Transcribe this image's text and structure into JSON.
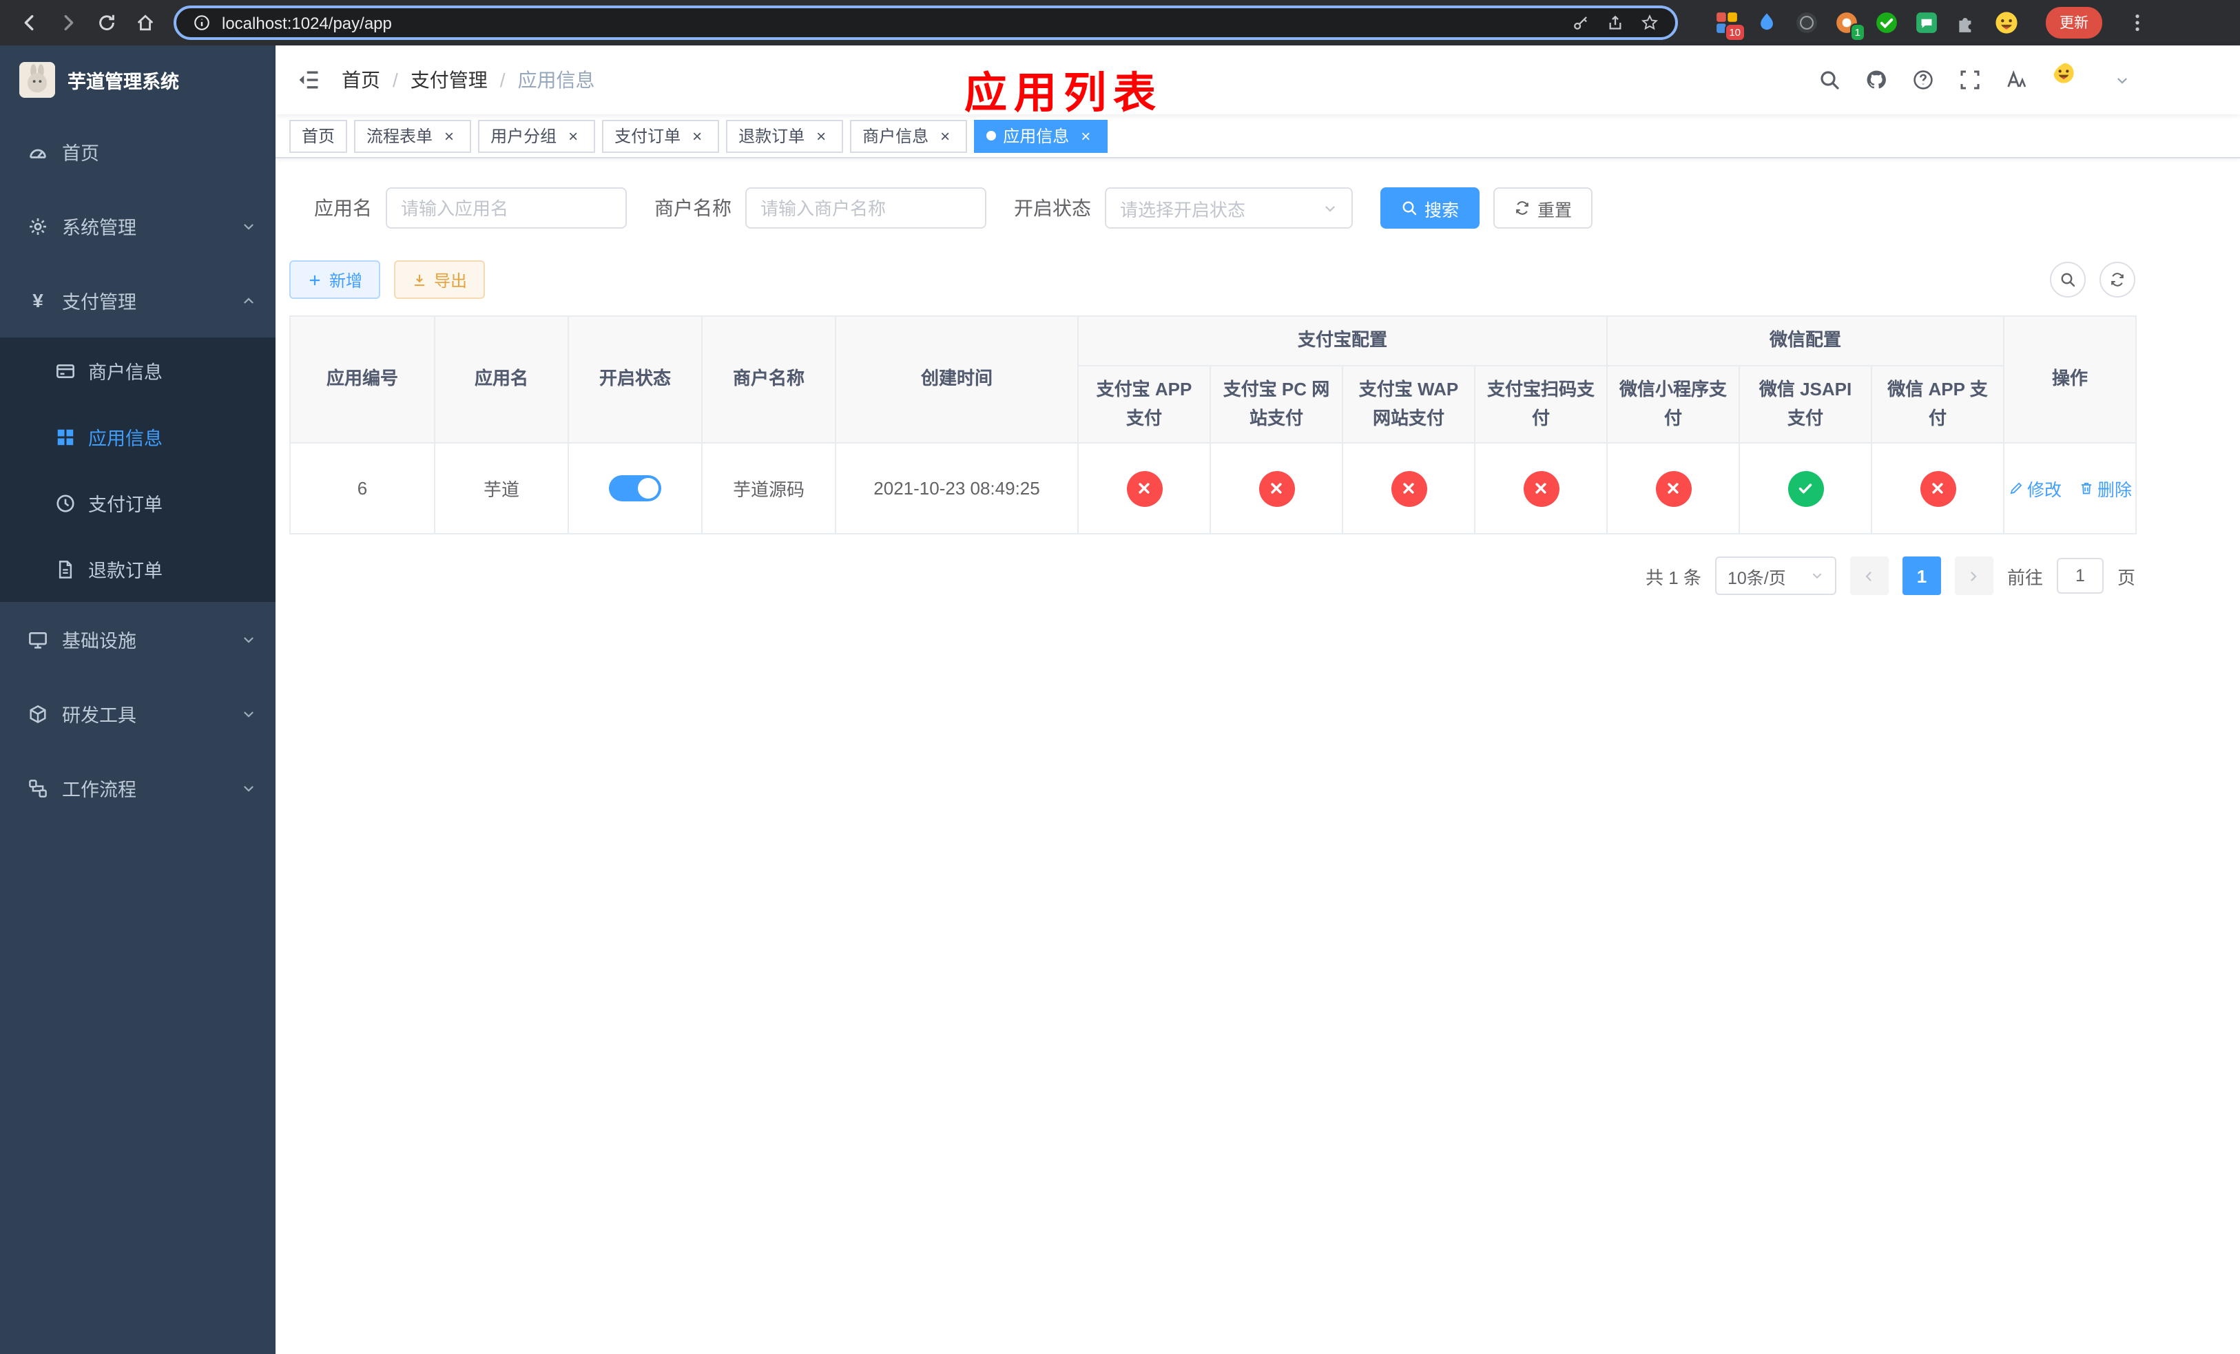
{
  "browser": {
    "url": "localhost:1024/pay/app",
    "update_button": "更新",
    "extension_badge_a": "10",
    "extension_badge_b": "1"
  },
  "sidebar": {
    "title": "芋道管理系统",
    "items": [
      {
        "label": "首页",
        "icon": "dashboard-icon",
        "expandable": false
      },
      {
        "label": "系统管理",
        "icon": "gear-icon",
        "expandable": true,
        "expanded": false
      },
      {
        "label": "支付管理",
        "icon": "yen-icon",
        "expandable": true,
        "expanded": true,
        "children": [
          {
            "label": "商户信息",
            "icon": "card-icon",
            "active": false
          },
          {
            "label": "应用信息",
            "icon": "grid-icon",
            "active": true
          },
          {
            "label": "支付订单",
            "icon": "clock-icon",
            "active": false
          },
          {
            "label": "退款订单",
            "icon": "document-icon",
            "active": false
          }
        ]
      },
      {
        "label": "基础设施",
        "icon": "monitor-icon",
        "expandable": true,
        "expanded": false
      },
      {
        "label": "研发工具",
        "icon": "cube-icon",
        "expandable": true,
        "expanded": false
      },
      {
        "label": "工作流程",
        "icon": "workflow-icon",
        "expandable": true,
        "expanded": false
      }
    ],
    "yen_glyph": "¥"
  },
  "header": {
    "breadcrumb": [
      "首页",
      "支付管理",
      "应用信息"
    ],
    "separator": "/",
    "annotation": "应用列表"
  },
  "tabs": [
    {
      "label": "首页",
      "closable": false,
      "active": false
    },
    {
      "label": "流程表单",
      "closable": true,
      "active": false
    },
    {
      "label": "用户分组",
      "closable": true,
      "active": false
    },
    {
      "label": "支付订单",
      "closable": true,
      "active": false
    },
    {
      "label": "退款订单",
      "closable": true,
      "active": false
    },
    {
      "label": "商户信息",
      "closable": true,
      "active": false
    },
    {
      "label": "应用信息",
      "closable": true,
      "active": true
    }
  ],
  "close_glyph": "×",
  "filters": {
    "app_name_label": "应用名",
    "app_name_placeholder": "请输入应用名",
    "merchant_label": "商户名称",
    "merchant_placeholder": "请输入商户名称",
    "status_label": "开启状态",
    "status_placeholder": "请选择开启状态",
    "search_button": "搜索",
    "reset_button": "重置"
  },
  "toolbar": {
    "add_button": "新增",
    "export_button": "导出"
  },
  "table": {
    "simple_columns": [
      "应用编号",
      "应用名",
      "开启状态",
      "商户名称",
      "创建时间"
    ],
    "groups": [
      {
        "label": "支付宝配置",
        "children": [
          "支付宝 APP 支付",
          "支付宝 PC 网站支付",
          "支付宝 WAP 网站支付",
          "支付宝扫码支付"
        ]
      },
      {
        "label": "微信配置",
        "children": [
          "微信小程序支付",
          "微信 JSAPI 支付",
          "微信 APP 支付"
        ]
      }
    ],
    "ops_column": "操作",
    "row": {
      "id": "6",
      "name": "芋道",
      "enabled": true,
      "merchant": "芋道源码",
      "created_at": "2021-10-23 08:49:25",
      "channels": [
        false,
        false,
        false,
        false,
        false,
        true,
        false
      ]
    },
    "edit_label": "修改",
    "delete_label": "删除"
  },
  "pagination": {
    "total_text": "共 1 条",
    "page_size": "10条/页",
    "current_page": "1",
    "goto_label": "前往",
    "goto_value": "1",
    "page_unit": "页"
  },
  "colors": {
    "accent": "#409eff",
    "status_on": "#17c06a",
    "status_off": "#fb4b4b",
    "annotation_red": "#ff0000",
    "sidebar_bg": "#304156",
    "submenu_bg": "#1f2d3d"
  },
  "icons": [
    "back-icon",
    "forward-icon",
    "reload-icon",
    "home-icon",
    "info-icon",
    "key-icon",
    "share-icon",
    "star-icon",
    "puzzle-icon",
    "menu-dots-icon",
    "fold-icon",
    "search-icon",
    "github-icon",
    "question-icon",
    "fullscreen-icon",
    "text-size-icon",
    "caret-down-icon",
    "plus-icon",
    "download-icon",
    "refresh-icon",
    "edit-icon",
    "trash-icon",
    "check-icon",
    "cross-icon",
    "dashboard-icon",
    "gear-icon",
    "yen-icon",
    "card-icon",
    "grid-icon",
    "clock-icon",
    "document-icon",
    "monitor-icon",
    "cube-icon",
    "workflow-icon"
  ]
}
